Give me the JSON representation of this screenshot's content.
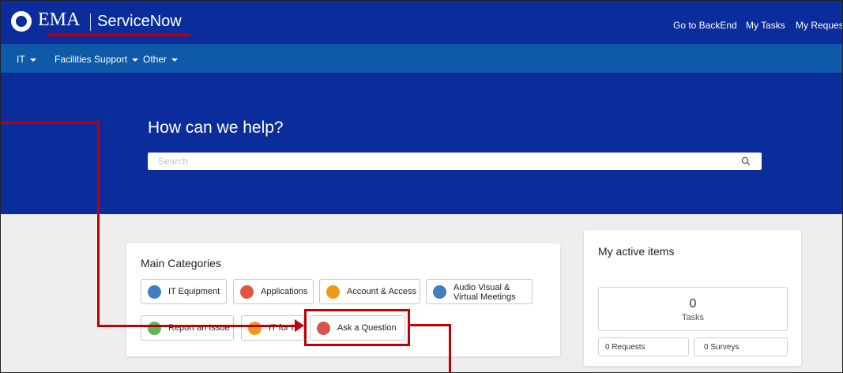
{
  "header": {
    "logo": "EMA",
    "app_name": "ServiceNow",
    "links": [
      "Go to BackEnd",
      "My Tasks",
      "My Requests"
    ]
  },
  "nav": {
    "items": [
      "IT",
      "Facilities Support",
      "Other"
    ]
  },
  "hero": {
    "title": "How can we help?",
    "search_placeholder": "Search"
  },
  "categories": {
    "title": "Main Categories",
    "items": [
      {
        "label": "IT Equipment",
        "icon": "it-equipment-icon",
        "color": "#3f7fbf"
      },
      {
        "label": "Applications",
        "icon": "applications-icon",
        "color": "#e0553c"
      },
      {
        "label": "Account & Access",
        "icon": "account-access-icon",
        "color": "#f09a1c"
      },
      {
        "label_line1": "Audio Visual &",
        "label_line2": "Virtual Meetings",
        "icon": "audio-visual-icon",
        "color": "#3f7fbf"
      },
      {
        "label": "Report an Issue",
        "icon": "report-issue-icon",
        "color": "#5cb85c"
      },
      {
        "label": "IT for I",
        "icon": "it-for-icon",
        "color": "#f09a1c"
      },
      {
        "label": "Ask a Question",
        "icon": "ask-question-icon",
        "color": "#d9534f"
      }
    ]
  },
  "active_items": {
    "title": "My active items",
    "tasks_count": "0",
    "tasks_label": "Tasks",
    "requests": "0 Requests",
    "surveys": "0 Surveys"
  },
  "colors": {
    "brand": "#0b2d9c",
    "navbar": "#0e5aa8",
    "annotation": "#c00000"
  }
}
